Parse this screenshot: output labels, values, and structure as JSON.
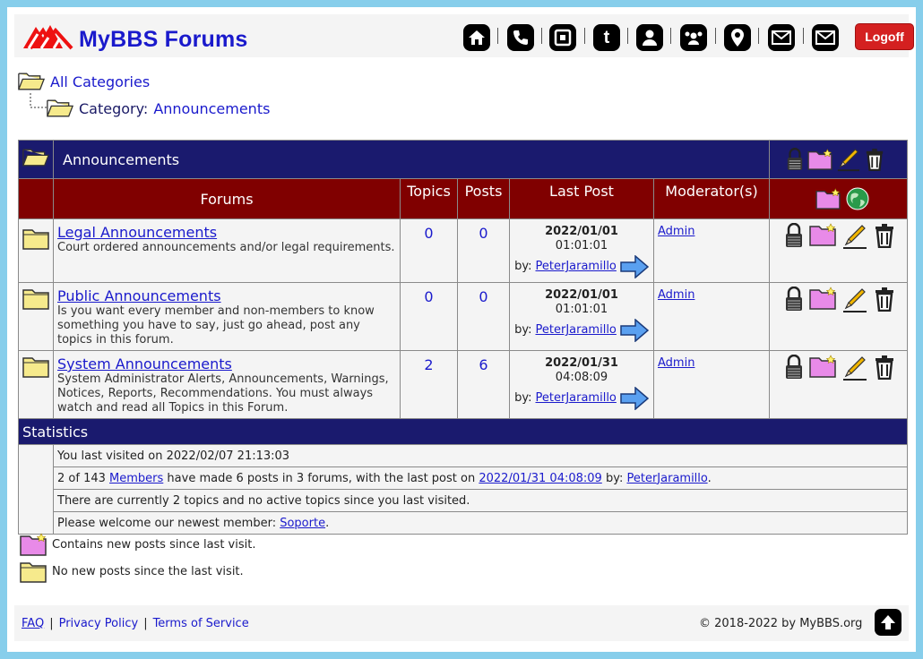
{
  "header": {
    "site_title": "MyBBS Forums",
    "nav_icons": [
      "home-icon",
      "phone-icon",
      "square-icon",
      "tumblr-icon",
      "user-icon",
      "group-icon",
      "map-pin-icon",
      "mail-icon",
      "mail-icon"
    ],
    "logoff_label": "Logoff"
  },
  "breadcrumb": {
    "all_categories": "All Categories",
    "category_prefix": "Category:",
    "category_name": "Announcements"
  },
  "category": {
    "name": "Announcements",
    "columns": {
      "forums": "Forums",
      "topics": "Topics",
      "posts": "Posts",
      "last_post": "Last Post",
      "moderators": "Moderator(s)"
    },
    "forums": [
      {
        "name": "Legal Announcements",
        "description": "Court ordered announcements and/or legal requirements.",
        "topics": "0",
        "posts": "0",
        "last_date": "2022/01/01",
        "last_time": "01:01:01",
        "by_label": "by:",
        "last_user": "PeterJaramillo",
        "moderator": "Admin"
      },
      {
        "name": "Public Announcements",
        "description": "Is you want every member and non-members to know something you have to say, just go ahead, post any topics in this forum.",
        "topics": "0",
        "posts": "0",
        "last_date": "2022/01/01",
        "last_time": "01:01:01",
        "by_label": "by:",
        "last_user": "PeterJaramillo",
        "moderator": "Admin"
      },
      {
        "name": "System Announcements",
        "description": "System Administrator Alerts, Announcements, Warnings, Notices, Reports, Recommendations. You must always watch and read all Topics in this Forum.",
        "topics": "2",
        "posts": "6",
        "last_date": "2022/01/31",
        "last_time": "04:08:09",
        "by_label": "by:",
        "last_user": "PeterJaramillo",
        "moderator": "Admin"
      }
    ]
  },
  "statistics": {
    "title": "Statistics",
    "last_visited": "You last visited on 2022/02/07 21:13:03",
    "members_pre": "2 of 143",
    "members_link": "Members",
    "members_mid": "have made 6 posts in 3 forums, with the last post on",
    "last_post_link": "2022/01/31 04:08:09",
    "members_by": "by:",
    "last_user_link": "PeterJaramillo",
    "members_end": ".",
    "topics_line": "There are currently 2 topics and no active topics since you last visited.",
    "welcome_pre": "Please welcome our newest member:",
    "newest_member": "Soporte",
    "welcome_end": "."
  },
  "legend": {
    "new_posts": "Contains new posts since last visit.",
    "no_new_posts": "No new posts since the last visit."
  },
  "footer": {
    "faq": "FAQ",
    "sep": "|",
    "privacy": "Privacy Policy",
    "terms": "Terms of Service",
    "copyright": "© 2018-2022 by MyBBS.org"
  },
  "colors": {
    "brand_blue": "#1a1acc",
    "category_bar": "#1a1a6e",
    "header_bar": "#800000",
    "logoff_red": "#d42020",
    "frame": "#87ceeb"
  }
}
